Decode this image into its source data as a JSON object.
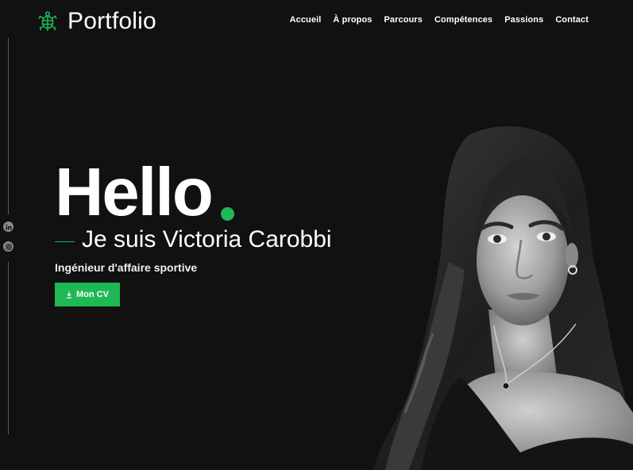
{
  "header": {
    "logo_text": "Portfolio",
    "logo_icon": "turtle-icon",
    "nav": [
      "Accueil",
      "À propos",
      "Parcours",
      "Compétences",
      "Passions",
      "Contact"
    ]
  },
  "social": [
    "linkedin-icon",
    "instagram-icon"
  ],
  "hero": {
    "title": "Hello",
    "intro": "Je suis Victoria Carobbi",
    "role": "Ingénieur d'affaire sportive",
    "cv_button_label": "Mon CV",
    "cv_button_icon": "download-icon"
  },
  "colors": {
    "background": "#111111",
    "accent": "#1fb854",
    "text": "#ffffff"
  }
}
